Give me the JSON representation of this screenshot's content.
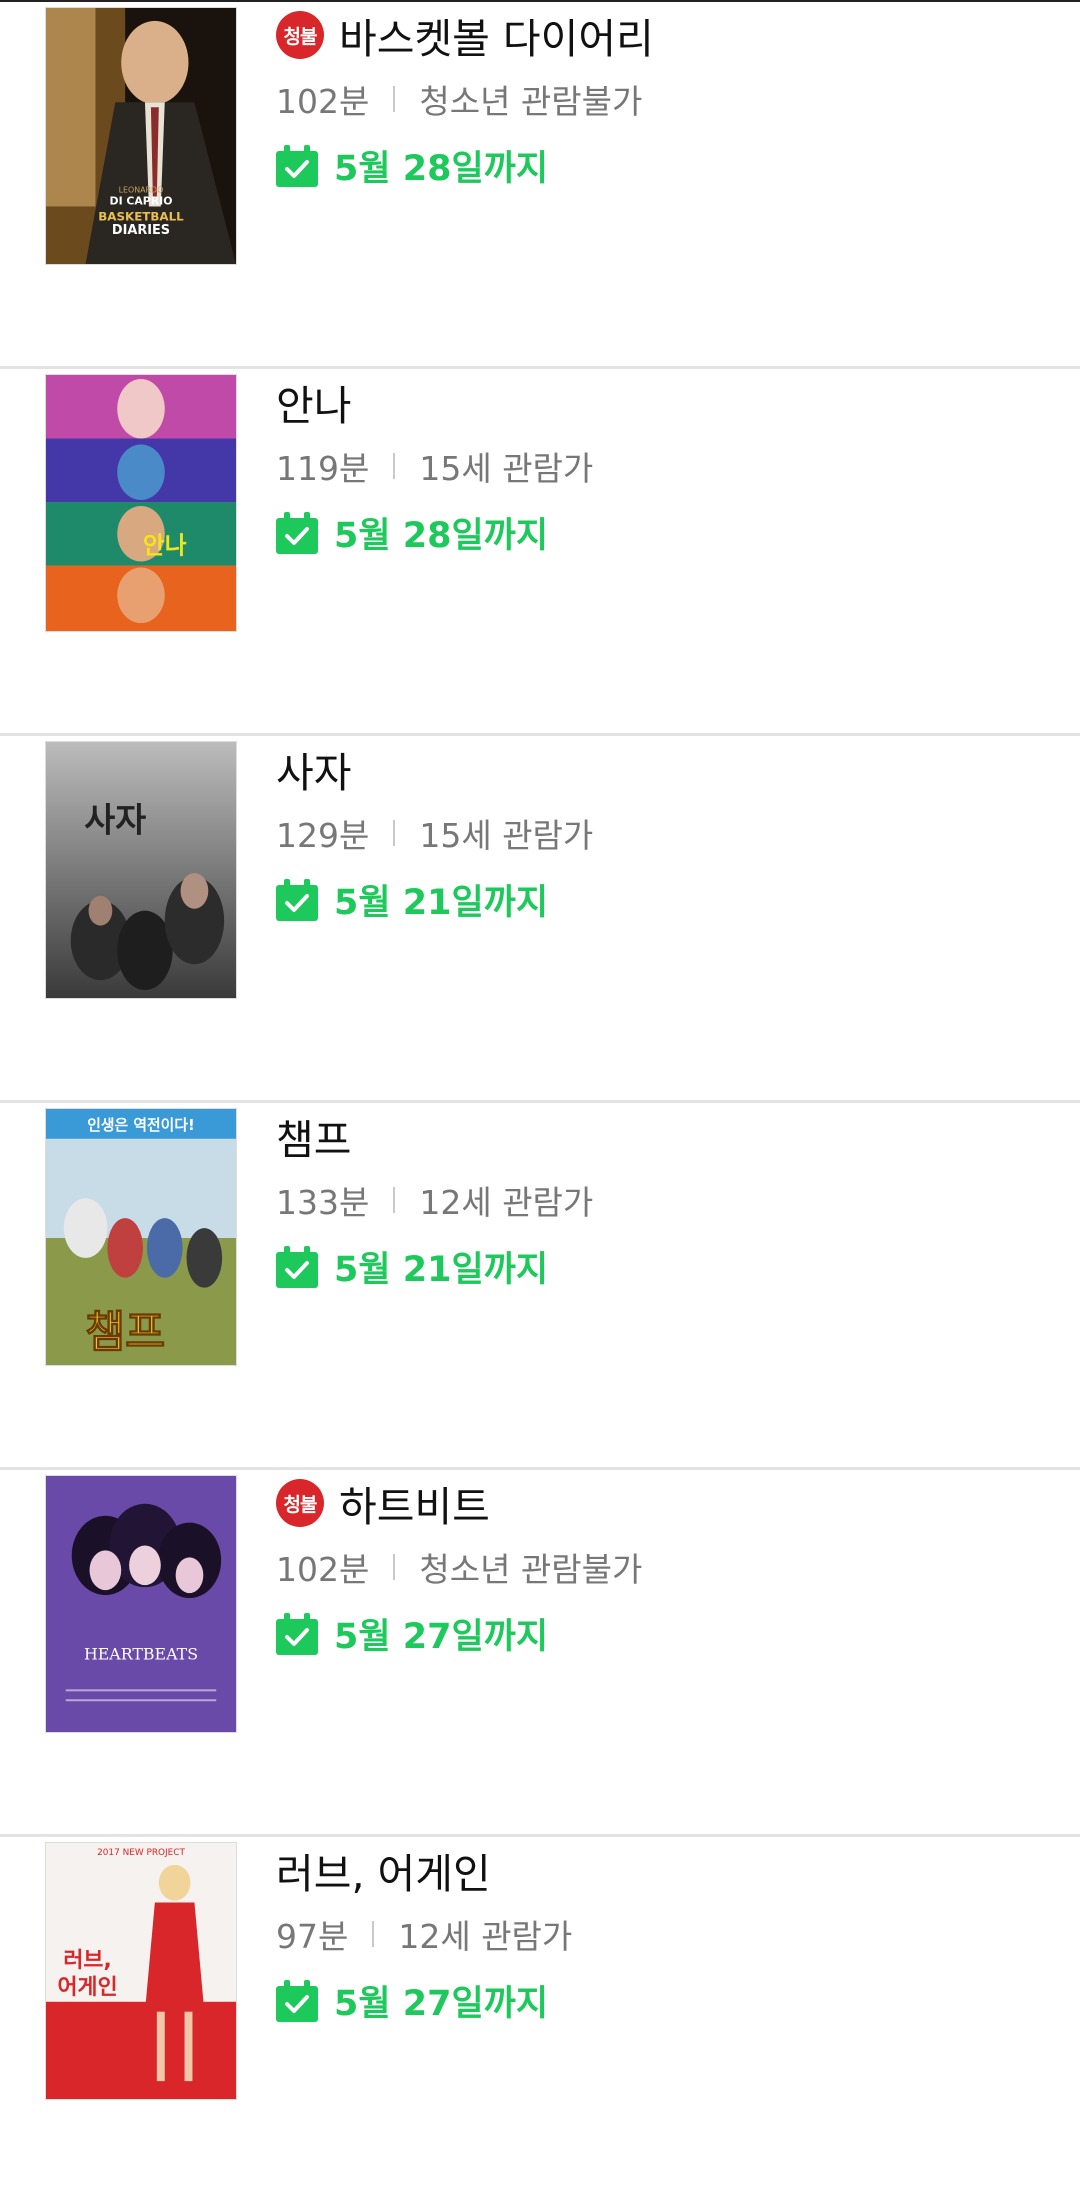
{
  "colors": {
    "accent_green": "#1ec95c",
    "badge_red": "#d8262a"
  },
  "movies": [
    {
      "title": "바스켓볼 다이어리",
      "badge": "청불",
      "runtime": "102분",
      "rating": "청소년 관람불가",
      "deadline": "5월 28일까지",
      "poster_text": [
        "LEONARDO",
        "DI CAPRIO",
        "BASKETBALL",
        "DIARIES"
      ]
    },
    {
      "title": "안나",
      "badge": "",
      "runtime": "119분",
      "rating": "15세 관람가",
      "deadline": "5월 28일까지",
      "poster_text": [
        "안나"
      ]
    },
    {
      "title": "사자",
      "badge": "",
      "runtime": "129분",
      "rating": "15세 관람가",
      "deadline": "5월 21일까지",
      "poster_text": [
        "사자"
      ]
    },
    {
      "title": "챔프",
      "badge": "",
      "runtime": "133분",
      "rating": "12세 관람가",
      "deadline": "5월 21일까지",
      "poster_text": [
        "인생은 역전이다!",
        "챔프"
      ]
    },
    {
      "title": "하트비트",
      "badge": "청불",
      "runtime": "102분",
      "rating": "청소년 관람불가",
      "deadline": "5월 27일까지",
      "poster_text": [
        "HEARTBEATS"
      ]
    },
    {
      "title": "러브, 어게인",
      "badge": "",
      "runtime": "97분",
      "rating": "12세 관람가",
      "deadline": "5월 27일까지",
      "poster_text": [
        "2017 NEW PROJECT",
        "러브,",
        "어게인"
      ]
    }
  ]
}
